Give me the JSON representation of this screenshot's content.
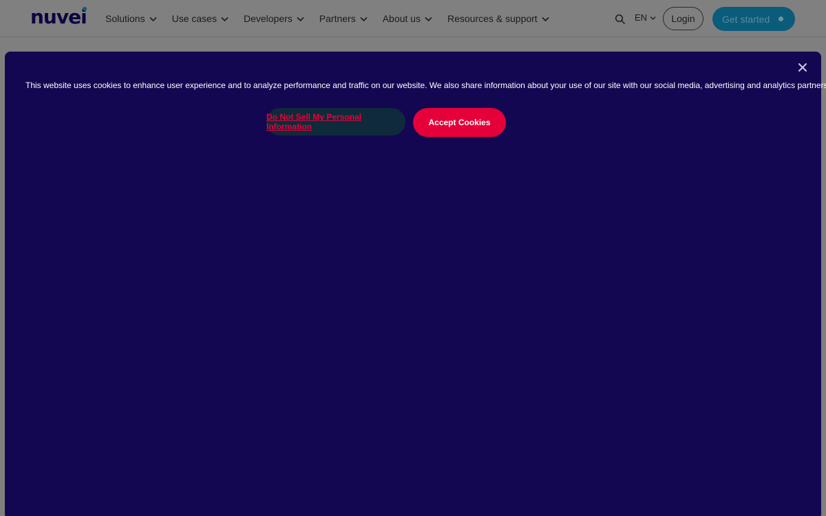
{
  "header": {
    "logo": "nuvei",
    "nav": [
      {
        "label": "Solutions"
      },
      {
        "label": "Use cases"
      },
      {
        "label": "Developers"
      },
      {
        "label": "Partners"
      },
      {
        "label": "About us"
      },
      {
        "label": "Resources & support"
      }
    ],
    "language": "EN",
    "login_label": "Login",
    "cta_label": "Get started"
  },
  "cookie_banner": {
    "message": "This website uses cookies to enhance user experience and to analyze performance and traffic on our website. We also share information about your use of our site with our social media, advertising and analytics partners.",
    "do_not_sell_label": "Do Not Sell My Personal Information",
    "accept_label": "Accept Cookies"
  },
  "colors": {
    "banner_bg": "#140751",
    "accent_red": "#e6003a",
    "brand_navy": "#0b0540",
    "brand_teal": "#0b5b7a"
  },
  "icons": {
    "search": "search-icon",
    "chevron": "chevron-down-icon",
    "close": "close-icon"
  }
}
